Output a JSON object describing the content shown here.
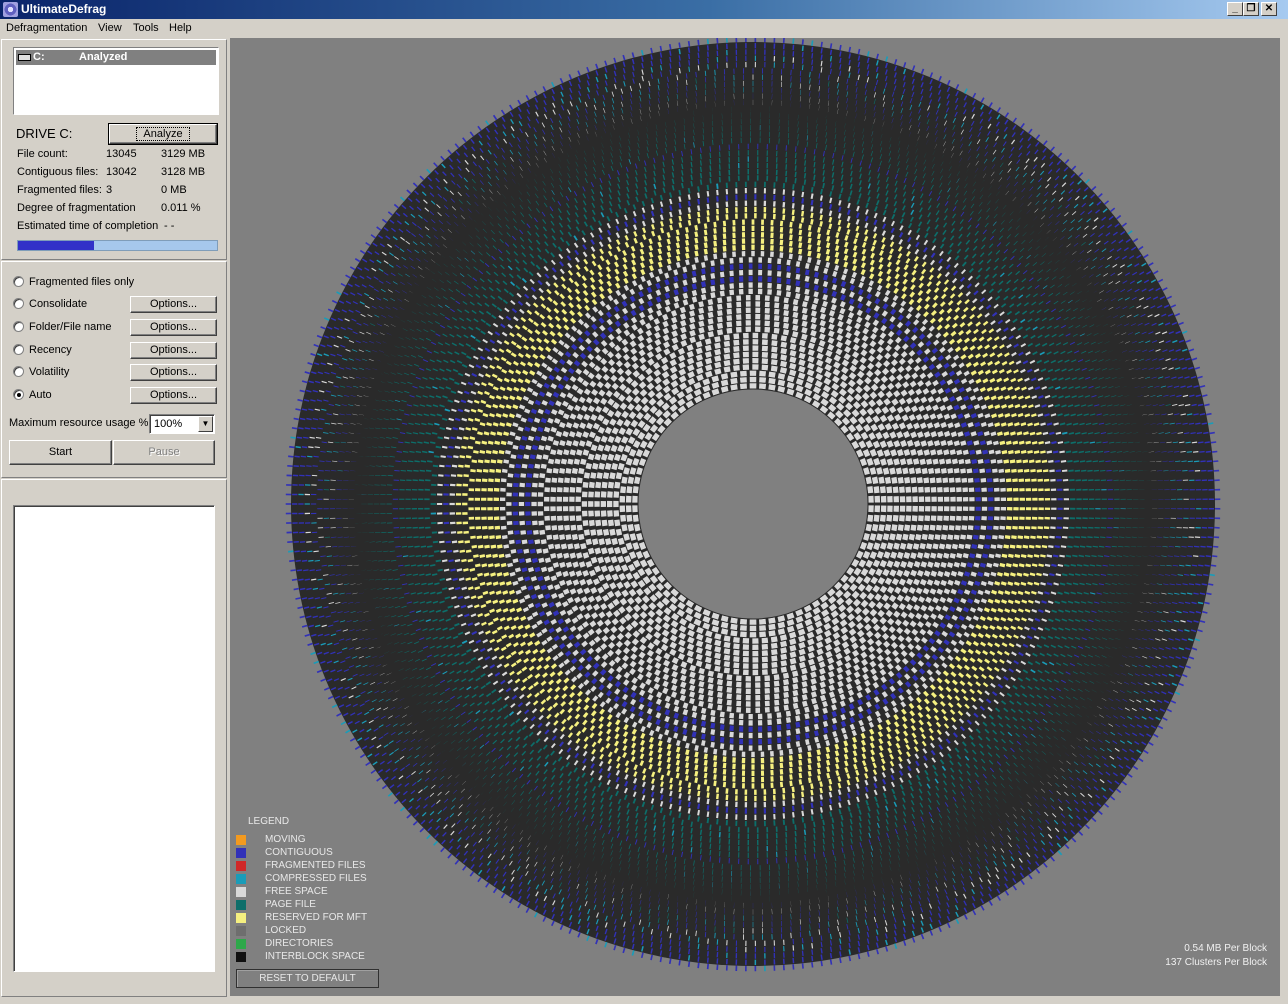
{
  "window": {
    "title": "UltimateDefrag"
  },
  "menu": [
    "Defragmentation",
    "View",
    "Tools",
    "Help"
  ],
  "drive_list": {
    "drive": "C:",
    "status": "Analyzed"
  },
  "drive_panel": {
    "title": "DRIVE C:",
    "analyze_label": "Analyze",
    "stats": [
      {
        "label": "File count:",
        "value": "13045",
        "size": "3129 MB"
      },
      {
        "label": "Contiguous files:",
        "value": "13042",
        "size": "3128 MB"
      },
      {
        "label": "Fragmented files:",
        "value": "3",
        "size": "0 MB"
      },
      {
        "label": "Degree of fragmentation",
        "value": "",
        "size": "0.011 %"
      },
      {
        "label": "Estimated time of completion",
        "value": "",
        "size": "- -"
      }
    ],
    "progress_fraction": 0.38
  },
  "options": {
    "modes": [
      {
        "label": "Fragmented files only",
        "checked": false,
        "has_options": false
      },
      {
        "label": "Consolidate",
        "checked": false,
        "has_options": true
      },
      {
        "label": "Folder/File name",
        "checked": false,
        "has_options": true
      },
      {
        "label": "Recency",
        "checked": false,
        "has_options": true
      },
      {
        "label": "Volatility",
        "checked": false,
        "has_options": true
      },
      {
        "label": "Auto",
        "checked": true,
        "has_options": true
      }
    ],
    "options_button_label": "Options...",
    "resource_label": "Maximum resource usage %",
    "resource_value": "100%",
    "start_label": "Start",
    "pause_label": "Pause"
  },
  "legend": {
    "title": "LEGEND",
    "items": [
      {
        "label": "MOVING",
        "color": "#f39a1f"
      },
      {
        "label": "CONTIGUOUS",
        "color": "#3131b8"
      },
      {
        "label": "FRAGMENTED FILES",
        "color": "#d02828"
      },
      {
        "label": "COMPRESSED FILES",
        "color": "#1a9cb8"
      },
      {
        "label": "FREE SPACE",
        "color": "#d9d9d9"
      },
      {
        "label": "PAGE FILE",
        "color": "#0d6e6a"
      },
      {
        "label": "RESERVED FOR MFT",
        "color": "#f5f080"
      },
      {
        "label": "LOCKED",
        "color": "#6e6e6e"
      },
      {
        "label": "DIRECTORIES",
        "color": "#2ea84a"
      },
      {
        "label": "INTERBLOCK SPACE",
        "color": "#101010"
      }
    ],
    "reset_label": "RESET TO DEFAULT"
  },
  "scale": {
    "mb_per_block": "0.54 MB Per Block",
    "clusters_per_block": "137 Clusters Per Block"
  },
  "disk_map": {
    "colors": {
      "contiguous": "#3131b8",
      "compressed": "#1a9cb8",
      "free": "#d9d9d9",
      "page": "#0d6e6a",
      "mft": "#f5f080",
      "locked": "#6e6e6e",
      "directories": "#2ea84a",
      "fragmented": "#d02828"
    }
  }
}
